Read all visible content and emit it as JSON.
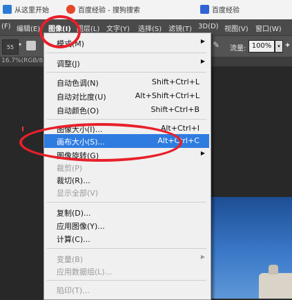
{
  "bookmarks": [
    {
      "label": "从这里开始",
      "icon": "home-icon",
      "color": "#2e7bd6"
    },
    {
      "label": "百度经验 - 搜狗搜索",
      "icon": "sogou-icon",
      "color": "#e8462b"
    },
    {
      "label": "百度经验",
      "icon": "baidu-icon",
      "color": "#2f63d6"
    }
  ],
  "menubar": {
    "file": "(F)",
    "edit": "编辑(E)",
    "image": "图像(I)",
    "layer": "图层(L)",
    "text": "文字(Y)",
    "select": "选择(S)",
    "filter": "滤镜(T)",
    "threed": "3D(D)",
    "view": "视图(V)",
    "window": "窗口(W)"
  },
  "optionsbar": {
    "brush_size": "55",
    "flow_label": "流量:",
    "flow_value": "100%"
  },
  "doctab": {
    "label": "16.7%(RGB/8"
  },
  "menu": {
    "items": [
      {
        "label": "模式(M)",
        "shortcut": "",
        "submenu": true,
        "disabled": false
      },
      {
        "label": "调整(J)",
        "shortcut": "",
        "submenu": true,
        "disabled": false
      },
      {
        "label": "自动色调(N)",
        "shortcut": "Shift+Ctrl+L",
        "submenu": false,
        "disabled": false
      },
      {
        "label": "自动对比度(U)",
        "shortcut": "Alt+Shift+Ctrl+L",
        "submenu": false,
        "disabled": false
      },
      {
        "label": "自动颜色(O)",
        "shortcut": "Shift+Ctrl+B",
        "submenu": false,
        "disabled": false
      },
      {
        "label": "图像大小(I)...",
        "shortcut": "Alt+Ctrl+I",
        "submenu": false,
        "disabled": false
      },
      {
        "label": "画布大小(S)...",
        "shortcut": "Alt+Ctrl+C",
        "submenu": false,
        "disabled": false,
        "highlighted": true
      },
      {
        "label": "图像旋转(G)",
        "shortcut": "",
        "submenu": true,
        "disabled": false
      },
      {
        "label": "裁剪(P)",
        "shortcut": "",
        "submenu": false,
        "disabled": true
      },
      {
        "label": "裁切(R)...",
        "shortcut": "",
        "submenu": false,
        "disabled": false
      },
      {
        "label": "显示全部(V)",
        "shortcut": "",
        "submenu": false,
        "disabled": true
      },
      {
        "label": "复制(D)...",
        "shortcut": "",
        "submenu": false,
        "disabled": false
      },
      {
        "label": "应用图像(Y)...",
        "shortcut": "",
        "submenu": false,
        "disabled": false
      },
      {
        "label": "计算(C)...",
        "shortcut": "",
        "submenu": false,
        "disabled": false
      },
      {
        "label": "变量(B)",
        "shortcut": "",
        "submenu": true,
        "disabled": true
      },
      {
        "label": "应用数据组(L)...",
        "shortcut": "",
        "submenu": false,
        "disabled": true
      },
      {
        "label": "陷印(T)...",
        "shortcut": "",
        "submenu": false,
        "disabled": true
      }
    ]
  },
  "colors": {
    "highlight": "#2f7ce0",
    "annotation": "#e8202a",
    "disabled_text": "#9a9a9a"
  }
}
